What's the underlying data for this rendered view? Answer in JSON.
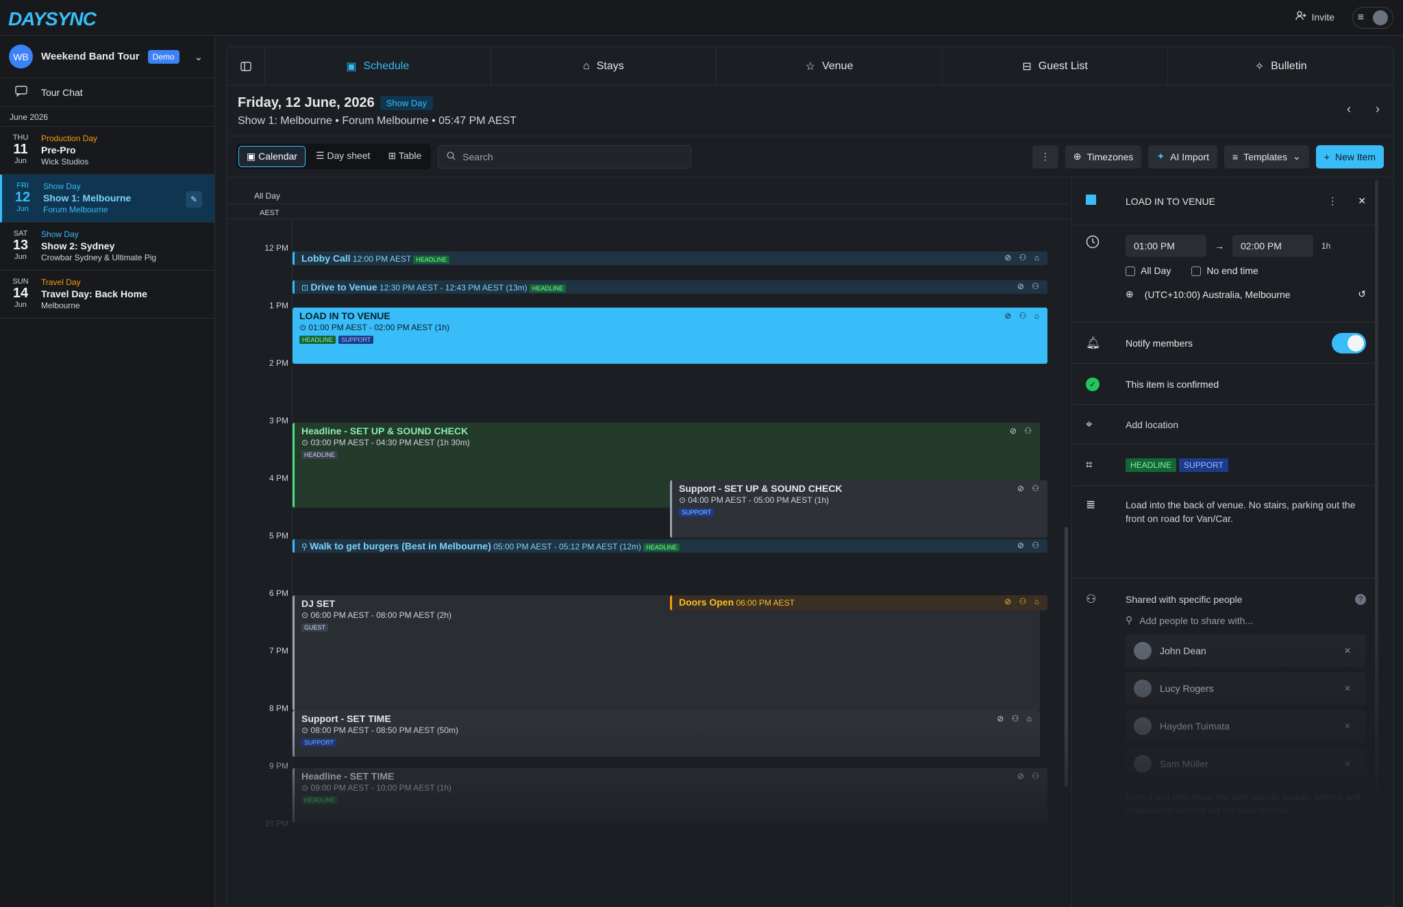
{
  "app": {
    "logo": "DAYSYNC"
  },
  "topbar": {
    "invite_label": "Invite"
  },
  "sidebar": {
    "tour_initials": "WB",
    "tour_name": "Weekend Band Tour",
    "demo_badge": "Demo",
    "tour_chat": "Tour Chat",
    "month": "June 2026",
    "days": [
      {
        "dow": "THU",
        "num": "11",
        "mon": "Jun",
        "type": "Production Day",
        "type_color": "#f59e0b",
        "title": "Pre-Pro",
        "loc": "Wick Studios"
      },
      {
        "dow": "FRI",
        "num": "12",
        "mon": "Jun",
        "type": "Show Day",
        "type_color": "#38bdf8",
        "title": "Show 1: Melbourne",
        "loc": "Forum Melbourne"
      },
      {
        "dow": "SAT",
        "num": "13",
        "mon": "Jun",
        "type": "Show Day",
        "type_color": "#38bdf8",
        "title": "Show 2: Sydney",
        "loc": "Crowbar Sydney & Ultimate Pig"
      },
      {
        "dow": "SUN",
        "num": "14",
        "mon": "Jun",
        "type": "Travel Day",
        "type_color": "#f59e0b",
        "title": "Travel Day: Back Home",
        "loc": "Melbourne"
      }
    ]
  },
  "tabs": [
    "Schedule",
    "Stays",
    "Venue",
    "Guest List",
    "Bulletin"
  ],
  "header": {
    "date": "Friday, 12 June, 2026",
    "badge": "Show Day",
    "show": "Show 1: Melbourne",
    "venue": "Forum Melbourne",
    "time": "05:47 PM AEST"
  },
  "toolbar": {
    "views": [
      "Calendar",
      "Day sheet",
      "Table"
    ],
    "search_placeholder": "Search",
    "timezones": "Timezones",
    "ai_import": "AI Import",
    "templates": "Templates",
    "new_item": "New Item"
  },
  "calendar": {
    "all_day": "All Day",
    "tz": "AEST",
    "hours": [
      "12 PM",
      "1 PM",
      "2 PM",
      "3 PM",
      "4 PM",
      "5 PM",
      "6 PM",
      "7 PM",
      "8 PM",
      "9 PM",
      "10 PM"
    ],
    "events": {
      "lobby": {
        "title": "Lobby Call",
        "time": "12:00 PM AEST",
        "tag": "HEADLINE"
      },
      "drive": {
        "title": "Drive to Venue",
        "time": "12:30 PM AEST  - 12:43 PM  AEST (13m)",
        "tag": "HEADLINE"
      },
      "loadin": {
        "title": "LOAD IN TO VENUE",
        "time": "01:00 PM AEST  - 02:00 PM  AEST (1h)",
        "tags": [
          "HEADLINE",
          "SUPPORT"
        ]
      },
      "hl_setup": {
        "title": "Headline - SET UP & SOUND CHECK",
        "time": "03:00 PM AEST  - 04:30 PM  AEST (1h 30m)",
        "tag": "HEADLINE"
      },
      "sp_setup": {
        "title": "Support - SET UP & SOUND CHECK",
        "time": "04:00 PM AEST  - 05:00 PM  AEST (1h)",
        "tag": "SUPPORT"
      },
      "walk": {
        "title": "Walk to get burgers (Best in Melbourne)",
        "time": "05:00 PM AEST  - 05:12 PM  AEST (12m)",
        "tag": "HEADLINE"
      },
      "djset": {
        "title": "DJ SET",
        "time": "06:00 PM AEST  - 08:00 PM  AEST (2h)",
        "tag": "GUEST"
      },
      "doors": {
        "title": "Doors Open",
        "time": "06:00 PM AEST"
      },
      "sp_settime": {
        "title": "Support - SET TIME",
        "time": "08:00 PM AEST  - 08:50 PM  AEST (50m)",
        "tag": "SUPPORT"
      },
      "hl_settime": {
        "title": "Headline - SET TIME",
        "time": "09:00 PM AEST  - 10:00 PM  AEST (1h)",
        "tag": "HEADLINE"
      }
    }
  },
  "detail": {
    "title": "LOAD IN TO VENUE",
    "start": "01:00 PM",
    "end": "02:00 PM",
    "duration": "1h",
    "all_day": "All Day",
    "no_end": "No end time",
    "timezone": "(UTC+10:00) Australia, Melbourne",
    "notify": "Notify members",
    "confirmed": "This item is confirmed",
    "location_placeholder": "Add location",
    "tags": [
      "HEADLINE",
      "SUPPORT"
    ],
    "notes": "Load into the back of venue. No stairs, parking out the front on road for Van/Car.",
    "shared": "Shared with specific people",
    "add_people_placeholder": "Add people to share with...",
    "people": [
      "John Dean",
      "Lucy Rogers",
      "Hayden Tuimata",
      "Sam Müller"
    ],
    "footnote": "Even if you only share this with specific people, admins and organization owners will still have access."
  }
}
